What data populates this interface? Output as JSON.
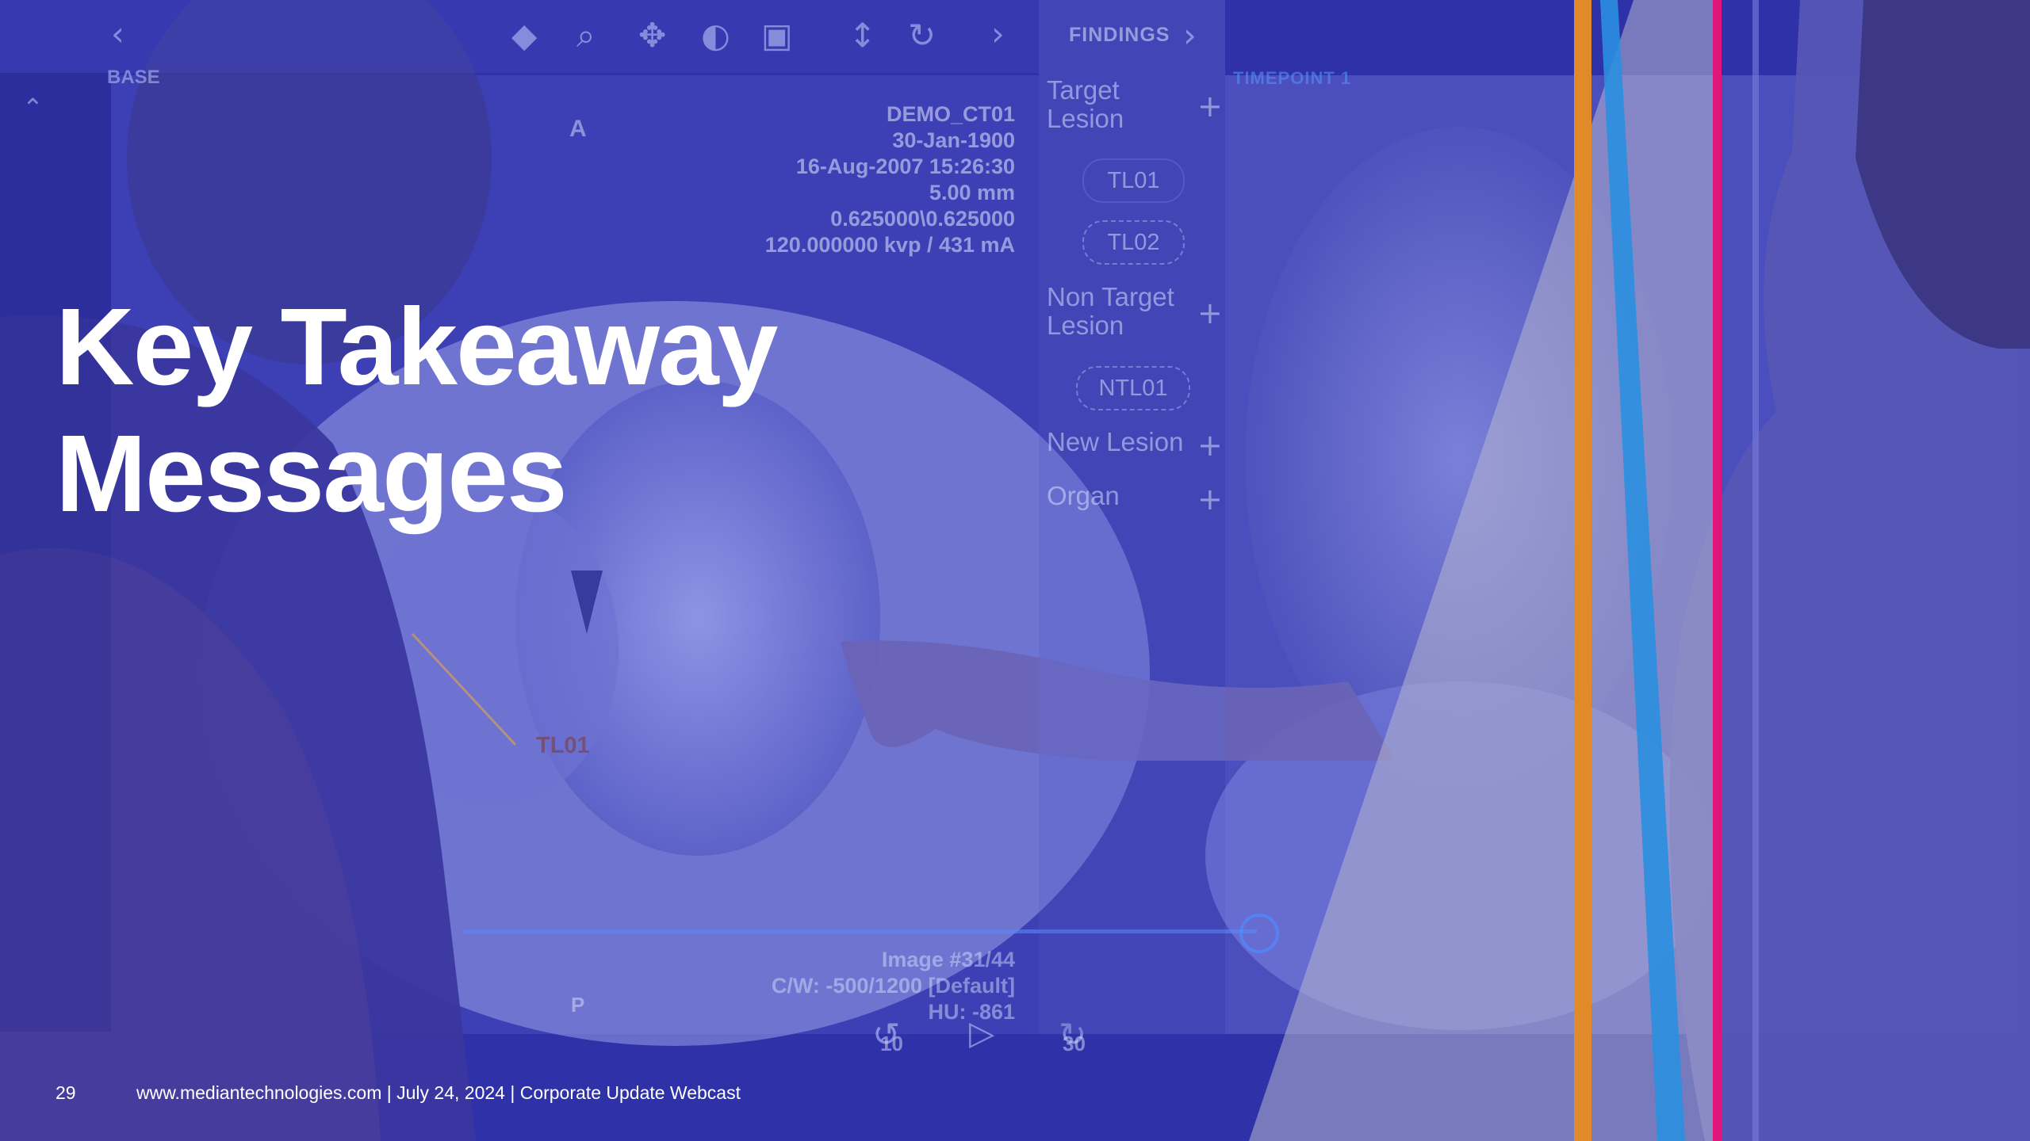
{
  "slide": {
    "title_lines": [
      "Key Takeaway",
      "Messages"
    ],
    "page_number": "29",
    "footer_text": "www.mediantechnologies.com | July 24, 2024 | Corporate Update Webcast"
  },
  "background": {
    "overlay_color": "#2e31a8",
    "accent_colors": [
      "#e08a2a",
      "#2a8fe0",
      "#e0157a"
    ],
    "viewer": {
      "baseline_tag": "BASE",
      "orientation_label": "A",
      "ct_info": [
        "DEMO_CT01",
        "30-Jan-1900",
        "16-Aug-2007 15:26:30",
        "5.00 mm",
        "0.625000\\0.625000",
        "120.000000 kvp / 431 mA"
      ],
      "image_info": [
        "Image #31/44",
        "C/W: -500/1200 [Default]",
        "HU: -861"
      ],
      "lesion_label": "TL01",
      "p_label": "P",
      "rewind_label": "10",
      "forward_label": "30",
      "timepoint_tag": "TIMEPOINT 1",
      "findings": {
        "header": "FINDINGS",
        "target_lesion": "Target\nLesion",
        "tl_items": [
          "TL01",
          "TL02"
        ],
        "non_target_lesion": "Non Target\nLesion",
        "ntl_items": [
          "NTL01"
        ],
        "new_lesion": "New Lesion",
        "organ": "Organ"
      }
    }
  }
}
